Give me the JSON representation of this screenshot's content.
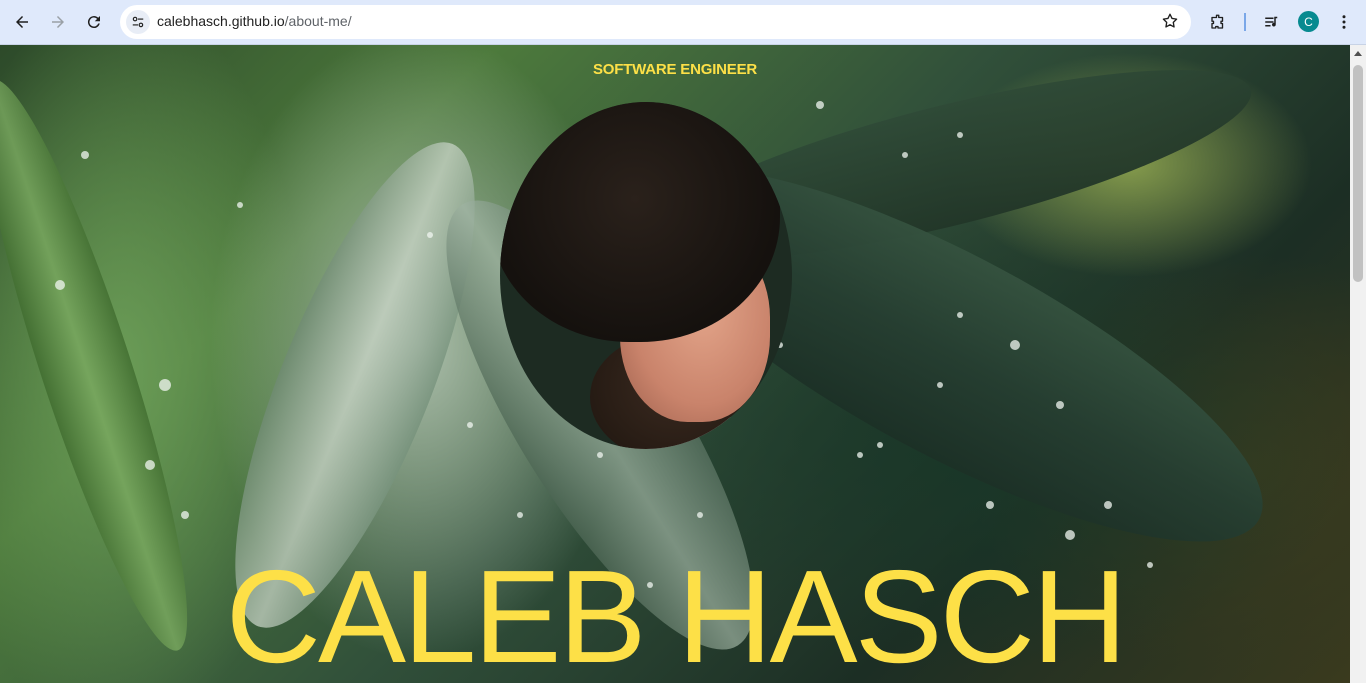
{
  "browser": {
    "url_host": "calebhasch.github.io",
    "url_path": "/about-me/",
    "profile_initial": "C",
    "accent": "#0b57d0"
  },
  "page": {
    "subtitle": "SOFTWARE ENGINEER",
    "name": "CALEB HASCH",
    "text_color": "#fde047"
  },
  "icons": [
    "back-icon",
    "forward-icon",
    "reload-icon",
    "site-info-icon",
    "bookmark-star-icon",
    "extensions-icon",
    "media-controls-icon",
    "menu-icon"
  ]
}
